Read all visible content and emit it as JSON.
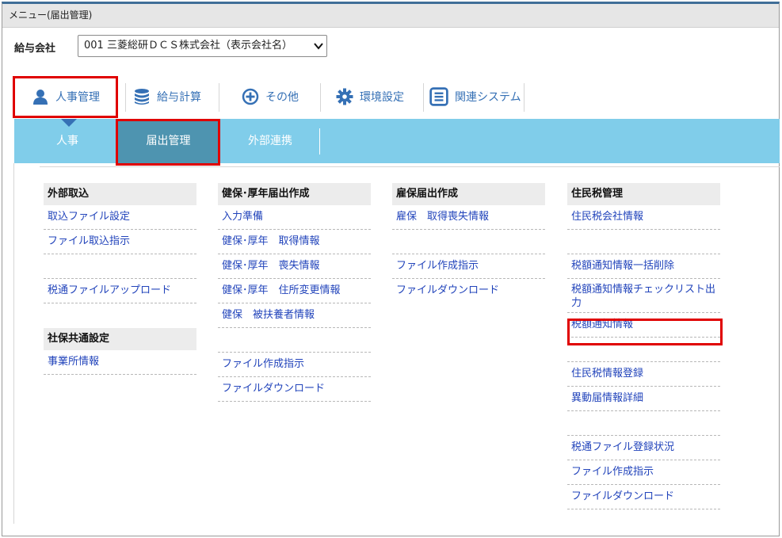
{
  "window": {
    "title": "メニュー(届出管理)"
  },
  "company": {
    "label": "給与会社",
    "selected": "001 三菱総研ＤＣＳ株式会社（表示会社名）"
  },
  "top_nav": [
    {
      "label": "人事管理",
      "icon": "person-icon"
    },
    {
      "label": "給与計算",
      "icon": "database-icon"
    },
    {
      "label": "その他",
      "icon": "plus-circle-icon"
    },
    {
      "label": "環境設定",
      "icon": "gear-icon"
    },
    {
      "label": "関連システム",
      "icon": "list-icon"
    }
  ],
  "sub_nav": [
    {
      "label": "人事"
    },
    {
      "label": "届出管理"
    },
    {
      "label": "外部連携"
    }
  ],
  "columns": {
    "gaibu": {
      "header": "外部取込",
      "items": [
        "取込ファイル設定",
        "ファイル取込指示",
        "",
        "税通ファイルアップロード"
      ],
      "header2": "社保共通設定",
      "items2": [
        "事業所情報"
      ]
    },
    "kenpo": {
      "header": "健保･厚年届出作成",
      "items": [
        "入力準備",
        "健保･厚年　取得情報",
        "健保･厚年　喪失情報",
        "健保･厚年　住所変更情報",
        "健保　被扶養者情報",
        "",
        "ファイル作成指示",
        "ファイルダウンロード"
      ]
    },
    "koho": {
      "header": "雇保届出作成",
      "items": [
        "雇保　取得喪失情報",
        "",
        "ファイル作成指示",
        "ファイルダウンロード"
      ]
    },
    "jumin": {
      "header": "住民税管理",
      "items": [
        "住民税会社情報",
        "",
        "税額通知情報一括削除",
        "税額通知情報チェックリスト出力",
        "税額通知情報",
        "",
        "住民税情報登録",
        "異動届情報詳細",
        "",
        "税通ファイル登録状況",
        "ファイル作成指示",
        "ファイルダウンロード"
      ]
    }
  },
  "colors": {
    "accent": "#3570b5",
    "subnav_bg": "#80cdea",
    "subnav_active": "#4e94b0",
    "highlight": "#e00000",
    "link": "#2244bb"
  }
}
